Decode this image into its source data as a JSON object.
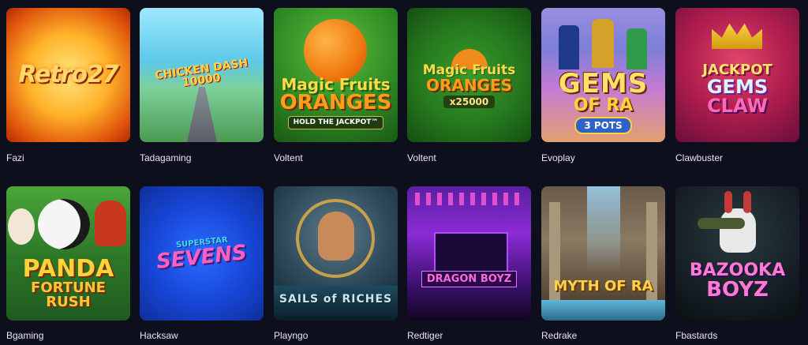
{
  "games": [
    {
      "provider": "Fazi",
      "art": [
        "Retro27"
      ]
    },
    {
      "provider": "Tadagaming",
      "art": [
        "CHICKEN DASH",
        "10000"
      ]
    },
    {
      "provider": "Voltent",
      "art": [
        "Magic Fruits",
        "ORANGES",
        "HOLD THE JACKPOT™"
      ]
    },
    {
      "provider": "Voltent",
      "art": [
        "Magic Fruits",
        "ORANGES",
        "x25000"
      ]
    },
    {
      "provider": "Evoplay",
      "art": [
        "GEMS",
        "OF RA",
        "3 POTS"
      ]
    },
    {
      "provider": "Clawbuster",
      "art": [
        "JACKPOT",
        "GEMS",
        "CLAW"
      ]
    },
    {
      "provider": "Bgaming",
      "art": [
        "PANDA",
        "FORTUNE RUSH"
      ]
    },
    {
      "provider": "Hacksaw",
      "art": [
        "SUPERSTAR",
        "SEVENS"
      ]
    },
    {
      "provider": "Playngo",
      "art": [
        "SAILS of RICHES"
      ]
    },
    {
      "provider": "Redtiger",
      "art": [
        "DRAGON BOYZ"
      ]
    },
    {
      "provider": "Redrake",
      "art": [
        "MYTH OF RA"
      ]
    },
    {
      "provider": "Fbastards",
      "art": [
        "BAZOOKA",
        "BOYZ"
      ]
    }
  ]
}
